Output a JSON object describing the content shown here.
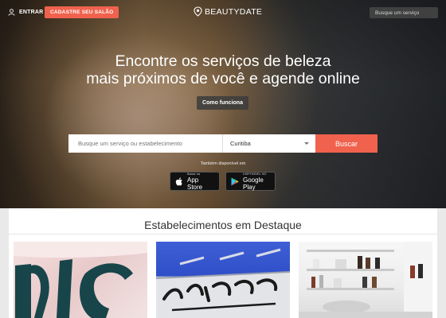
{
  "header": {
    "login_label": "ENTRAR",
    "register_label": "CADASTRE SEU SALÃO",
    "logo_text": "BEAUTYDATE",
    "search_placeholder": "Busque um serviço"
  },
  "hero": {
    "headline_line1": "Encontre os serviços de beleza",
    "headline_line2": "mais próximos de você e agende online",
    "how_it_works_label": "Como funciona",
    "search": {
      "placeholder": "Busque um serviço ou estabelecimento",
      "city_value": "Curitiba",
      "button_label": "Buscar"
    },
    "available_text": "Também disponível em",
    "stores": {
      "appstore_small": "Baixar na",
      "appstore_big": "App Store",
      "googleplay_small": "DISPONÍVEL NO",
      "googleplay_big": "Google Play"
    }
  },
  "featured": {
    "title": "Estabelecimentos em Destaque",
    "cards": [
      {
        "icon": "salon-photo-pink"
      },
      {
        "icon": "salon-photo-sign"
      },
      {
        "icon": "salon-photo-interior"
      }
    ]
  },
  "colors": {
    "accent": "#f0624d",
    "dark_button": "#3c3c3c"
  }
}
